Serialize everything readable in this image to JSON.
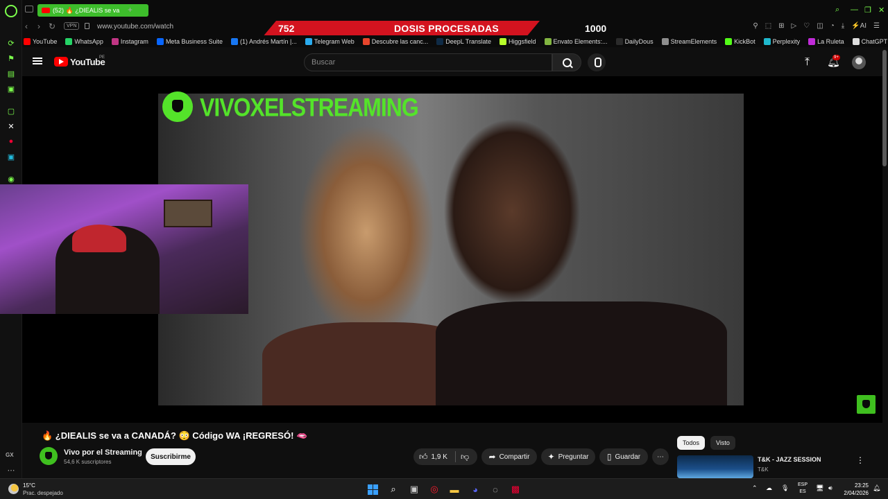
{
  "browser": {
    "tab_label": "(52) 🔥 ¿DIEALIS se va",
    "url": "www.youtube.com/watch",
    "vpn_label": "VPN",
    "gx_label": "GX"
  },
  "stream_banner": {
    "left_value": "752",
    "center_text": "DOSIS PROCESADAS",
    "right_value": "1000"
  },
  "bookmarks": [
    {
      "label": "YouTube",
      "color": "#ff0000"
    },
    {
      "label": "WhatsApp",
      "color": "#25d366"
    },
    {
      "label": "Instagram",
      "color": "#c13584"
    },
    {
      "label": "Meta Business Suite",
      "color": "#0866ff"
    },
    {
      "label": "(1) Andrés Martín |...",
      "color": "#1877f2"
    },
    {
      "label": "Telegram Web",
      "color": "#2aabee"
    },
    {
      "label": "Descubre las canc...",
      "color": "#e8452c"
    },
    {
      "label": "DeepL Translate",
      "color": "#0f2b46"
    },
    {
      "label": "Higgsfield",
      "color": "#b7ff2a"
    },
    {
      "label": "Envato Elements:...",
      "color": "#82b541"
    },
    {
      "label": "DailyDous",
      "color": "#2b2b2b"
    },
    {
      "label": "StreamElements",
      "color": "#8e8e8e"
    },
    {
      "label": "KickBot",
      "color": "#53fc18"
    },
    {
      "label": "Perplexity",
      "color": "#1fb8cd"
    },
    {
      "label": "La Ruleta",
      "color": "#c02bd8"
    },
    {
      "label": "ChatGPT",
      "color": "#dddddd"
    }
  ],
  "youtube": {
    "logo_text": "YouTube",
    "country_code": "PE",
    "search_placeholder": "Buscar",
    "notifications_badge": "9+"
  },
  "video": {
    "overlay_channel": "VIVOXELSTREAMING",
    "title": "🔥 ¿DIEALIS se va a CANADÁ? 😳 Código WA ¡REGRESÓ! 🫦",
    "channel_name": "Vivo por el Streaming",
    "subscribers": "54,6 K suscriptores",
    "subscribe_label": "Suscribirme",
    "likes": "1,9 K",
    "share_label": "Compartir",
    "ask_label": "Preguntar",
    "save_label": "Guardar"
  },
  "sidebar_recs": {
    "chips": [
      "Todos",
      "Visto"
    ],
    "first": {
      "title": "T&K - JAZZ SESSION",
      "channel": "T&K"
    }
  },
  "taskbar": {
    "temperature": "15°C",
    "weather": "Prac. despejado",
    "lang_top": "ESP",
    "lang_bottom": "ES",
    "time": "23:25",
    "date": "2/04/2026"
  }
}
